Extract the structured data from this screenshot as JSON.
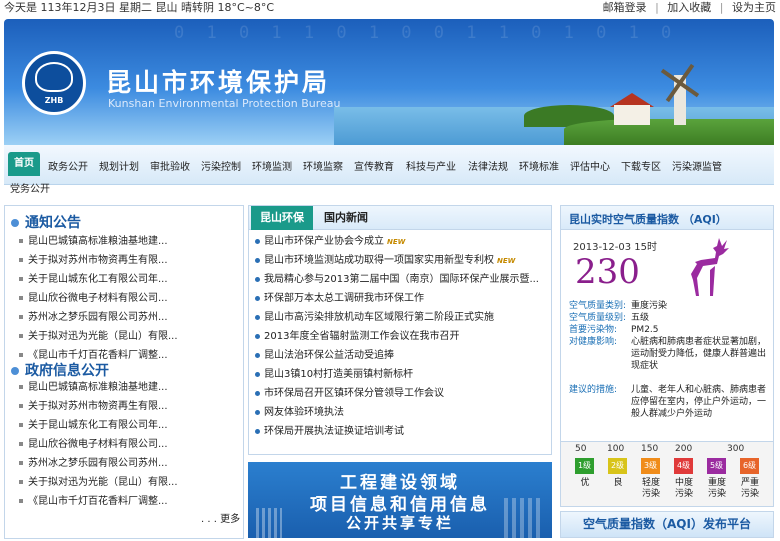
{
  "topbar": {
    "date_text": "今天是  113年12月3日  星期二  昆山  晴转阴  18°C~8°C",
    "links": [
      "邮箱登录",
      "加入收藏",
      "设为主页"
    ]
  },
  "banner": {
    "title_cn": "昆山市环境保护局",
    "title_en": "Kunshan Environmental Protection Bureau",
    "logo_text": "ZHB"
  },
  "nav": {
    "items": [
      "首页",
      "政务公开",
      "规划计划",
      "审批验收",
      "污染控制",
      "环境监测",
      "环境监察",
      "宣传教育",
      "科技与产业",
      "法律法规",
      "环境标准",
      "评估中心",
      "下载专区",
      "污染源监管"
    ],
    "sub": "党务公开"
  },
  "notice": {
    "title": "通知公告",
    "items": [
      "昆山巴城镇高标准粮油基地建...",
      "关于拟对苏州市物资再生有限...",
      "关于昆山城东化工有限公司年...",
      "昆山欣谷微电子材料有限公司...",
      "苏州冰之梦乐园有限公司苏州...",
      "关于拟对迅为光能（昆山）有限...",
      "《昆山市千灯百花香料厂调整..."
    ]
  },
  "gov_info": {
    "title": "政府信息公开",
    "items": [
      "昆山巴城镇高标准粮油基地建...",
      "关于拟对苏州市物资再生有限...",
      "关于昆山城东化工有限公司年...",
      "昆山欣谷微电子材料有限公司...",
      "苏州冰之梦乐园有限公司苏州...",
      "关于拟对迅为光能（昆山）有限...",
      "《昆山市千灯百花香料厂调整..."
    ],
    "more": "更多"
  },
  "news": {
    "tab_active": "昆山环保",
    "tab_other": "国内新闻",
    "new_label": "NEW",
    "items": [
      {
        "text": "昆山市环保产业协会今成立",
        "new": true
      },
      {
        "text": "昆山市环境监测站成功取得一项国家实用新型专利权",
        "new": true
      },
      {
        "text": "我局精心参与2013第二届中国（南京）国际环保产业展示暨...",
        "new": false
      },
      {
        "text": "环保部万本太总工调研我市环保工作",
        "new": false
      },
      {
        "text": "昆山市高污染排放机动车区域限行第二阶段正式实施",
        "new": false
      },
      {
        "text": "2013年度全省辐射监测工作会议在我市召开",
        "new": false
      },
      {
        "text": "昆山法治环保公益活动受追捧",
        "new": false
      },
      {
        "text": "昆山3镇10村打造美丽镇村新标杆",
        "new": false
      },
      {
        "text": "市环保局召开区镇环保分管领导工作会议",
        "new": false
      },
      {
        "text": "网友体验环境执法",
        "new": false
      },
      {
        "text": "环保局开展执法证换证培训考试",
        "new": false
      }
    ]
  },
  "promo": {
    "line1": "工程建设领域",
    "line2": "项目信息和信用信息",
    "line3": "公开共享专栏"
  },
  "aqi": {
    "title": "昆山实时空气质量指数 （AQI）",
    "time": "2013-12-03 15时",
    "value": "230",
    "rows": [
      {
        "k": "空气质量类别:",
        "v": "重度污染"
      },
      {
        "k": "空气质量级别:",
        "v": "五级"
      },
      {
        "k": "首要污染物:",
        "v": "PM2.5"
      },
      {
        "k": "对健康影响:",
        "v": "心脏病和肺病患者症状显著加剧，运动耐受力降低，健康人群普遍出现症状"
      },
      {
        "k": "建议的措施:",
        "v": "儿童、老年人和心脏病、肺病患者应停留在室内，停止户外运动，一般人群减少户外运动"
      }
    ],
    "scale_nums": [
      "50",
      "100",
      "150",
      "200",
      "300"
    ],
    "levels": [
      {
        "tag": "1级",
        "label": "优",
        "color": "#2e9e2e"
      },
      {
        "tag": "2级",
        "label": "良",
        "color": "#d8c41a"
      },
      {
        "tag": "3级",
        "label": "轻度污染",
        "color": "#f08c1a"
      },
      {
        "tag": "4级",
        "label": "中度污染",
        "color": "#e03a3a"
      },
      {
        "tag": "5级",
        "label": "重度污染",
        "color": "#9b2ba0"
      },
      {
        "tag": "6级",
        "label": "严重污染",
        "color": "#e7642a"
      }
    ],
    "footer": "空气质量指数（AQI）发布平台",
    "accent": "#8a1f8c"
  }
}
